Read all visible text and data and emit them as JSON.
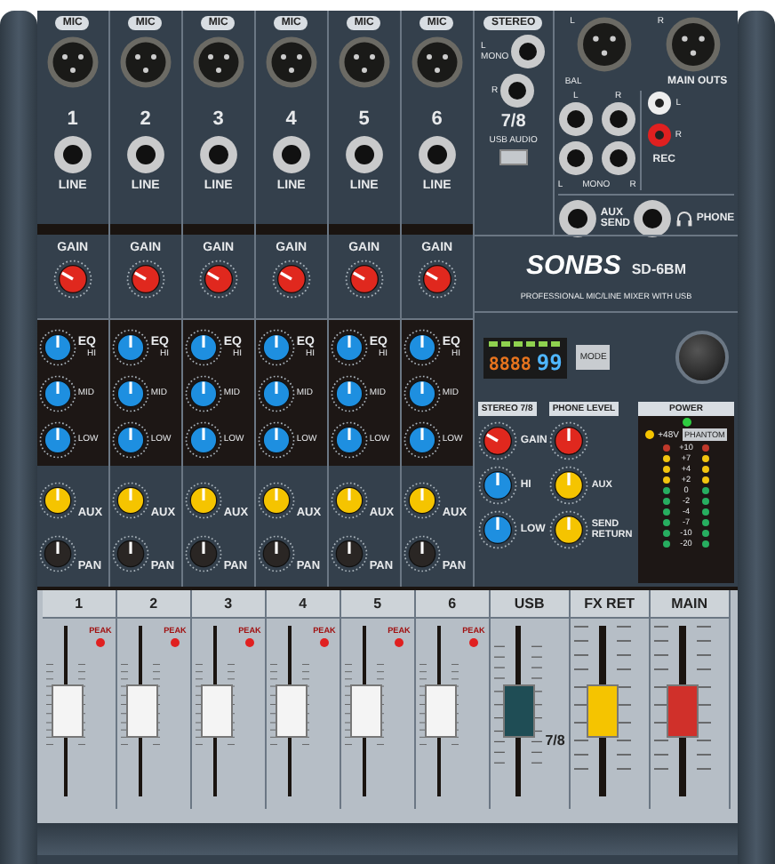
{
  "channels": [
    {
      "mic_label": "MIC",
      "number": "1",
      "line_label": "LINE",
      "gain": {
        "label": "GAIN"
      },
      "eq_label": "EQ",
      "eq": [
        {
          "label": "HI"
        },
        {
          "label": "MID"
        },
        {
          "label": "LOW"
        }
      ],
      "aux": {
        "label": "AUX"
      },
      "pan": {
        "label": "PAN"
      }
    },
    {
      "mic_label": "MIC",
      "number": "2",
      "line_label": "LINE",
      "gain": {
        "label": "GAIN"
      },
      "eq_label": "EQ",
      "eq": [
        {
          "label": "HI"
        },
        {
          "label": "MID"
        },
        {
          "label": "LOW"
        }
      ],
      "aux": {
        "label": "AUX"
      },
      "pan": {
        "label": "PAN"
      }
    },
    {
      "mic_label": "MIC",
      "number": "3",
      "line_label": "LINE",
      "gain": {
        "label": "GAIN"
      },
      "eq_label": "EQ",
      "eq": [
        {
          "label": "HI"
        },
        {
          "label": "MID"
        },
        {
          "label": "LOW"
        }
      ],
      "aux": {
        "label": "AUX"
      },
      "pan": {
        "label": "PAN"
      }
    },
    {
      "mic_label": "MIC",
      "number": "4",
      "line_label": "LINE",
      "gain": {
        "label": "GAIN"
      },
      "eq_label": "EQ",
      "eq": [
        {
          "label": "HI"
        },
        {
          "label": "MID"
        },
        {
          "label": "LOW"
        }
      ],
      "aux": {
        "label": "AUX"
      },
      "pan": {
        "label": "PAN"
      }
    },
    {
      "mic_label": "MIC",
      "number": "5",
      "line_label": "LINE",
      "gain": {
        "label": "GAIN"
      },
      "eq_label": "EQ",
      "eq": [
        {
          "label": "HI"
        },
        {
          "label": "MID"
        },
        {
          "label": "LOW"
        }
      ],
      "aux": {
        "label": "AUX"
      },
      "pan": {
        "label": "PAN"
      }
    },
    {
      "mic_label": "MIC",
      "number": "6",
      "line_label": "LINE",
      "gain": {
        "label": "GAIN"
      },
      "eq_label": "EQ",
      "eq": [
        {
          "label": "HI"
        },
        {
          "label": "MID"
        },
        {
          "label": "LOW"
        }
      ],
      "aux": {
        "label": "AUX"
      },
      "pan": {
        "label": "PAN"
      }
    }
  ],
  "stereo_input": {
    "label": "STEREO",
    "jacks": [
      {
        "label": "L",
        "sub": "MONO"
      },
      {
        "label": "R"
      }
    ],
    "number": "7/8",
    "usb_label": "USB AUDIO"
  },
  "outputs": {
    "xlr": [
      {
        "label": "L"
      },
      {
        "label": "R"
      }
    ],
    "bal_label": "BAL",
    "main_outs_label": "MAIN OUTS",
    "main_jacks": [
      {
        "label": "L"
      },
      {
        "label": "R"
      }
    ],
    "return_jacks": [
      {
        "label": "L"
      },
      {
        "label": "MONO"
      },
      {
        "label": "R"
      }
    ],
    "rec": [
      {
        "label": "L",
        "color": "#eeeeee"
      },
      {
        "label": "R",
        "color": "#e02020"
      }
    ],
    "rec_label": "REC",
    "aux_send_label": "AUX SEND",
    "phone_label": "PHONE"
  },
  "brand": {
    "logo": "SONBS",
    "model": "SD-6BM",
    "tagline": "PROFESSIONAL MIC/LINE MIXER WITH USB"
  },
  "player": {
    "digits": "8888",
    "track": "99",
    "mode_label": "MODE"
  },
  "stereo_78": {
    "title": "STEREO 7/8",
    "knobs": [
      {
        "kind": "gain",
        "label": "GAIN"
      },
      {
        "kind": "eq",
        "label": "HI"
      },
      {
        "kind": "eq",
        "label": "LOW"
      }
    ]
  },
  "phone_level": {
    "title": "PHONE LEVEL"
  },
  "aux_return": [
    {
      "label": "AUX"
    },
    {
      "label": "SEND RETURN"
    }
  ],
  "power": {
    "label": "POWER",
    "on": true,
    "phantom_label": "PHANTOM",
    "phantom_led_label": "+48V",
    "phantom_on": true
  },
  "meter": [
    {
      "label": "+10",
      "color": "#c0392b"
    },
    {
      "label": "+7",
      "color": "#f1c40f"
    },
    {
      "label": "+4",
      "color": "#f1c40f"
    },
    {
      "label": "+2",
      "color": "#f1c40f"
    },
    {
      "label": "0",
      "color": "#27ae60"
    },
    {
      "label": "-2",
      "color": "#27ae60"
    },
    {
      "label": "-4",
      "color": "#27ae60"
    },
    {
      "label": "-7",
      "color": "#27ae60"
    },
    {
      "label": "-10",
      "color": "#27ae60"
    },
    {
      "label": "-20",
      "color": "#27ae60"
    }
  ],
  "strips": [
    {
      "kind": "channel",
      "label": "1",
      "peak_label": "PEAK",
      "level": 0.5
    },
    {
      "kind": "channel",
      "label": "2",
      "peak_label": "PEAK",
      "level": 0.5
    },
    {
      "kind": "channel",
      "label": "3",
      "peak_label": "PEAK",
      "level": 0.5
    },
    {
      "kind": "channel",
      "label": "4",
      "peak_label": "PEAK",
      "level": 0.5
    },
    {
      "kind": "channel",
      "label": "5",
      "peak_label": "PEAK",
      "level": 0.5
    },
    {
      "kind": "channel",
      "label": "6",
      "peak_label": "PEAK",
      "level": 0.5
    },
    {
      "kind": "usb",
      "label": "USB",
      "sub": "7/8",
      "level": 0.5
    },
    {
      "kind": "fx",
      "label": "FX RET",
      "level": 0.5
    },
    {
      "kind": "main",
      "label": "MAIN",
      "level": 0.5
    }
  ]
}
